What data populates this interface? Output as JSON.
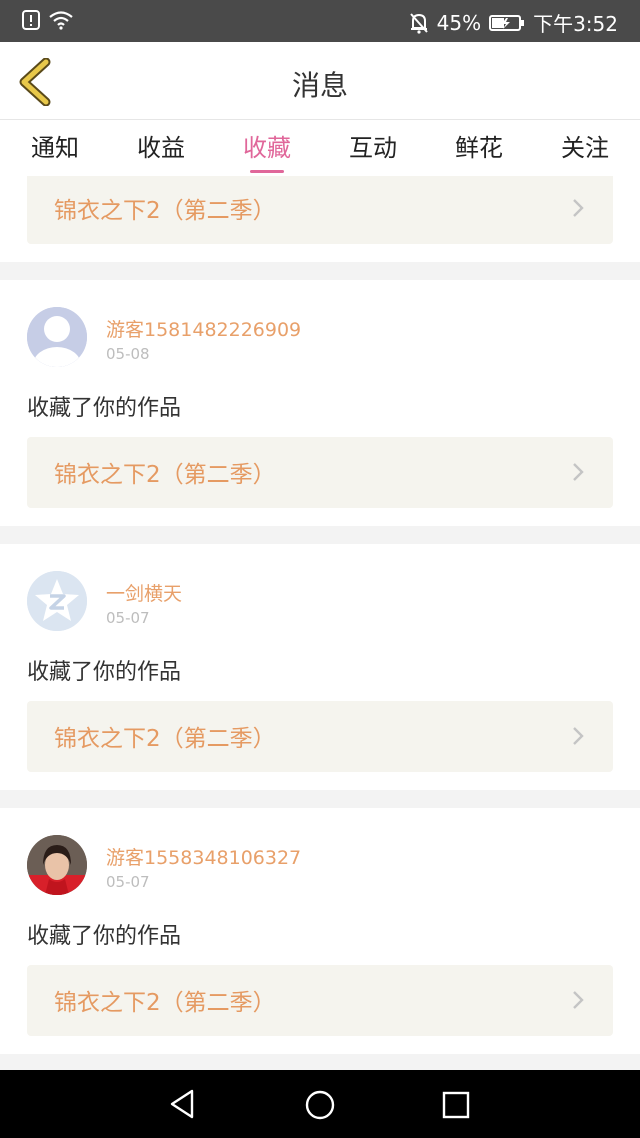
{
  "status_bar": {
    "battery_pct": "45%",
    "time": "下午3:52"
  },
  "header": {
    "title": "消息"
  },
  "tabs": [
    {
      "label": "通知",
      "active": false
    },
    {
      "label": "收益",
      "active": false
    },
    {
      "label": "收藏",
      "active": true
    },
    {
      "label": "互动",
      "active": false
    },
    {
      "label": "鲜花",
      "active": false
    },
    {
      "label": "关注",
      "active": false
    }
  ],
  "partial_card": {
    "work_title": "锦衣之下2（第二季）"
  },
  "messages": [
    {
      "username": "游客1581482226909",
      "date": "05-08",
      "action_text": "收藏了你的作品",
      "work_title": "锦衣之下2（第二季）",
      "avatar": "default-person-avatar"
    },
    {
      "username": "一剑横天",
      "date": "05-07",
      "action_text": "收藏了你的作品",
      "work_title": "锦衣之下2（第二季）",
      "avatar": "qq-star-avatar"
    },
    {
      "username": "游客1558348106327",
      "date": "05-07",
      "action_text": "收藏了你的作品",
      "work_title": "锦衣之下2（第二季）",
      "avatar": "photo-avatar"
    }
  ],
  "colors": {
    "accent_pink": "#e0679a",
    "username_orange": "#e8a06a",
    "work_title_orange": "#e59a62",
    "card_bg": "#f5f4ee",
    "back_arrow": "#e8c84a"
  }
}
